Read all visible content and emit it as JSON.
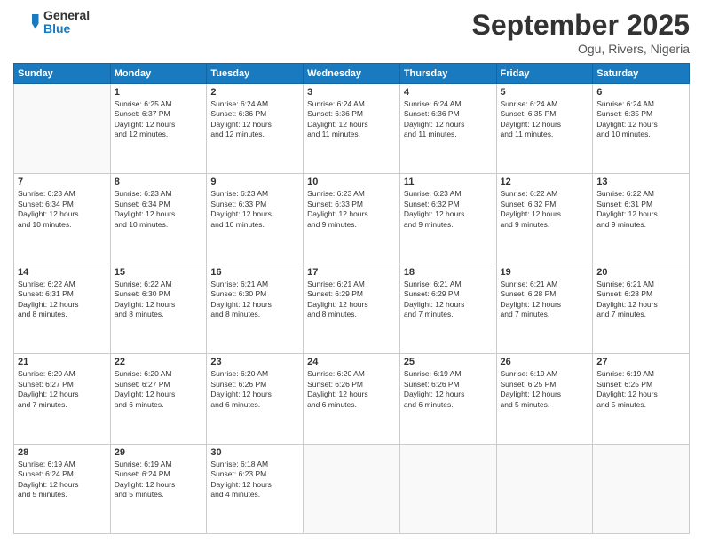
{
  "logo": {
    "general": "General",
    "blue": "Blue"
  },
  "title": "September 2025",
  "location": "Ogu, Rivers, Nigeria",
  "days_of_week": [
    "Sunday",
    "Monday",
    "Tuesday",
    "Wednesday",
    "Thursday",
    "Friday",
    "Saturday"
  ],
  "weeks": [
    [
      {
        "num": "",
        "info": ""
      },
      {
        "num": "1",
        "info": "Sunrise: 6:25 AM\nSunset: 6:37 PM\nDaylight: 12 hours\nand 12 minutes."
      },
      {
        "num": "2",
        "info": "Sunrise: 6:24 AM\nSunset: 6:36 PM\nDaylight: 12 hours\nand 12 minutes."
      },
      {
        "num": "3",
        "info": "Sunrise: 6:24 AM\nSunset: 6:36 PM\nDaylight: 12 hours\nand 11 minutes."
      },
      {
        "num": "4",
        "info": "Sunrise: 6:24 AM\nSunset: 6:36 PM\nDaylight: 12 hours\nand 11 minutes."
      },
      {
        "num": "5",
        "info": "Sunrise: 6:24 AM\nSunset: 6:35 PM\nDaylight: 12 hours\nand 11 minutes."
      },
      {
        "num": "6",
        "info": "Sunrise: 6:24 AM\nSunset: 6:35 PM\nDaylight: 12 hours\nand 10 minutes."
      }
    ],
    [
      {
        "num": "7",
        "info": "Sunrise: 6:23 AM\nSunset: 6:34 PM\nDaylight: 12 hours\nand 10 minutes."
      },
      {
        "num": "8",
        "info": "Sunrise: 6:23 AM\nSunset: 6:34 PM\nDaylight: 12 hours\nand 10 minutes."
      },
      {
        "num": "9",
        "info": "Sunrise: 6:23 AM\nSunset: 6:33 PM\nDaylight: 12 hours\nand 10 minutes."
      },
      {
        "num": "10",
        "info": "Sunrise: 6:23 AM\nSunset: 6:33 PM\nDaylight: 12 hours\nand 9 minutes."
      },
      {
        "num": "11",
        "info": "Sunrise: 6:23 AM\nSunset: 6:32 PM\nDaylight: 12 hours\nand 9 minutes."
      },
      {
        "num": "12",
        "info": "Sunrise: 6:22 AM\nSunset: 6:32 PM\nDaylight: 12 hours\nand 9 minutes."
      },
      {
        "num": "13",
        "info": "Sunrise: 6:22 AM\nSunset: 6:31 PM\nDaylight: 12 hours\nand 9 minutes."
      }
    ],
    [
      {
        "num": "14",
        "info": "Sunrise: 6:22 AM\nSunset: 6:31 PM\nDaylight: 12 hours\nand 8 minutes."
      },
      {
        "num": "15",
        "info": "Sunrise: 6:22 AM\nSunset: 6:30 PM\nDaylight: 12 hours\nand 8 minutes."
      },
      {
        "num": "16",
        "info": "Sunrise: 6:21 AM\nSunset: 6:30 PM\nDaylight: 12 hours\nand 8 minutes."
      },
      {
        "num": "17",
        "info": "Sunrise: 6:21 AM\nSunset: 6:29 PM\nDaylight: 12 hours\nand 8 minutes."
      },
      {
        "num": "18",
        "info": "Sunrise: 6:21 AM\nSunset: 6:29 PM\nDaylight: 12 hours\nand 7 minutes."
      },
      {
        "num": "19",
        "info": "Sunrise: 6:21 AM\nSunset: 6:28 PM\nDaylight: 12 hours\nand 7 minutes."
      },
      {
        "num": "20",
        "info": "Sunrise: 6:21 AM\nSunset: 6:28 PM\nDaylight: 12 hours\nand 7 minutes."
      }
    ],
    [
      {
        "num": "21",
        "info": "Sunrise: 6:20 AM\nSunset: 6:27 PM\nDaylight: 12 hours\nand 7 minutes."
      },
      {
        "num": "22",
        "info": "Sunrise: 6:20 AM\nSunset: 6:27 PM\nDaylight: 12 hours\nand 6 minutes."
      },
      {
        "num": "23",
        "info": "Sunrise: 6:20 AM\nSunset: 6:26 PM\nDaylight: 12 hours\nand 6 minutes."
      },
      {
        "num": "24",
        "info": "Sunrise: 6:20 AM\nSunset: 6:26 PM\nDaylight: 12 hours\nand 6 minutes."
      },
      {
        "num": "25",
        "info": "Sunrise: 6:19 AM\nSunset: 6:26 PM\nDaylight: 12 hours\nand 6 minutes."
      },
      {
        "num": "26",
        "info": "Sunrise: 6:19 AM\nSunset: 6:25 PM\nDaylight: 12 hours\nand 5 minutes."
      },
      {
        "num": "27",
        "info": "Sunrise: 6:19 AM\nSunset: 6:25 PM\nDaylight: 12 hours\nand 5 minutes."
      }
    ],
    [
      {
        "num": "28",
        "info": "Sunrise: 6:19 AM\nSunset: 6:24 PM\nDaylight: 12 hours\nand 5 minutes."
      },
      {
        "num": "29",
        "info": "Sunrise: 6:19 AM\nSunset: 6:24 PM\nDaylight: 12 hours\nand 5 minutes."
      },
      {
        "num": "30",
        "info": "Sunrise: 6:18 AM\nSunset: 6:23 PM\nDaylight: 12 hours\nand 4 minutes."
      },
      {
        "num": "",
        "info": ""
      },
      {
        "num": "",
        "info": ""
      },
      {
        "num": "",
        "info": ""
      },
      {
        "num": "",
        "info": ""
      }
    ]
  ]
}
